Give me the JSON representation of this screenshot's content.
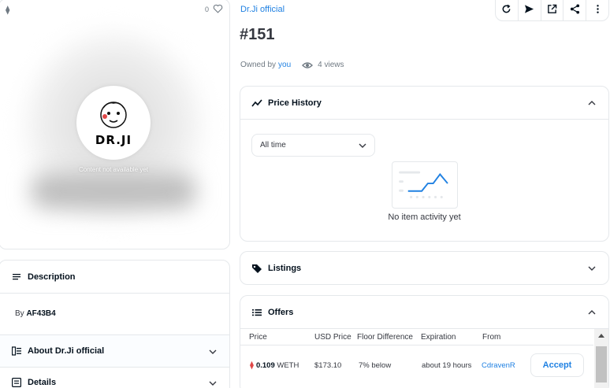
{
  "media": {
    "eth_symbol": "⧫",
    "favorites_count": "0",
    "logo_text": "DR.JI",
    "placeholder": "Content not available yet"
  },
  "description": {
    "title": "Description",
    "by_prefix": "By",
    "creator": "AF43B4"
  },
  "about": {
    "title": "About Dr.Ji official"
  },
  "details": {
    "title": "Details"
  },
  "item": {
    "collection": "Dr.Ji official",
    "title": "#151",
    "owned_by_prefix": "Owned by",
    "owner": "you",
    "views": "4 views"
  },
  "price_history": {
    "title": "Price History",
    "range": "All time",
    "empty": "No item activity yet"
  },
  "listings": {
    "title": "Listings"
  },
  "offers": {
    "title": "Offers",
    "columns": [
      "Price",
      "USD Price",
      "Floor Difference",
      "Expiration",
      "From"
    ],
    "rows": [
      {
        "price": "0.109",
        "currency": "WETH",
        "usd": "$173.10",
        "floor": "7% below",
        "expiration": "about 19 hours",
        "from": "CdravenR",
        "action": "Accept"
      }
    ]
  },
  "colors": {
    "accent": "#2081e2",
    "border": "#e5e8eb",
    "weth": "#e04848"
  }
}
